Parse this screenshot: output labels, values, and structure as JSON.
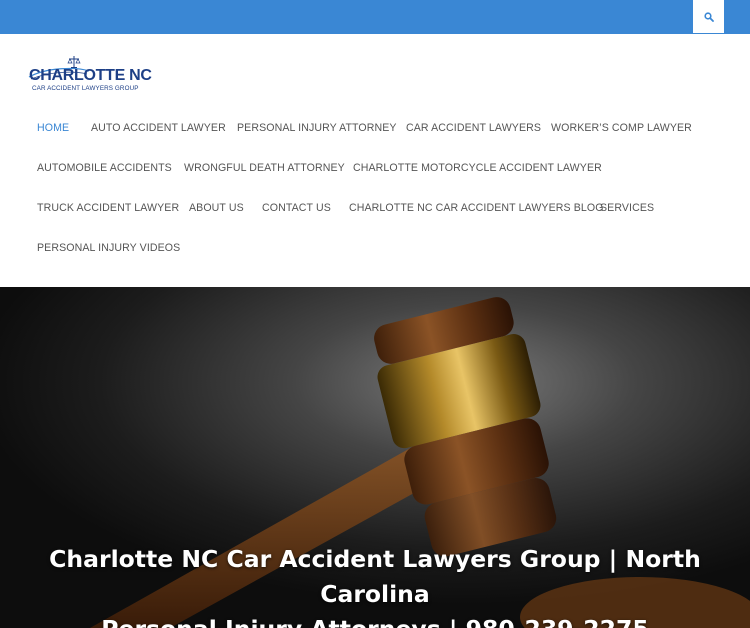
{
  "header": {
    "search_icon": "search-icon",
    "bar_color": "#3a87d4"
  },
  "logo": {
    "title": "CHARLOTTE NC",
    "subtitle": "CAR ACCIDENT LAWYERS GROUP"
  },
  "nav": {
    "active_color": "#3a87d4",
    "items": [
      {
        "label": "HOME",
        "active": true
      },
      {
        "label": "AUTO ACCIDENT LAWYER"
      },
      {
        "label": "PERSONAL INJURY ATTORNEY"
      },
      {
        "label": "CAR ACCIDENT LAWYERS"
      },
      {
        "label": "WORKER’S COMP LAWYER"
      },
      {
        "label": "AUTOMOBILE ACCIDENTS"
      },
      {
        "label": "WRONGFUL DEATH ATTORNEY"
      },
      {
        "label": "CHARLOTTE MOTORCYCLE ACCIDENT LAWYER"
      },
      {
        "label": "TRUCK ACCIDENT LAWYER"
      },
      {
        "label": "ABOUT US"
      },
      {
        "label": "CONTACT US"
      },
      {
        "label": "CHARLOTTE NC CAR ACCIDENT LAWYERS BLOG"
      },
      {
        "label": "SERVICES"
      },
      {
        "label": "PERSONAL INJURY VIDEOS"
      }
    ]
  },
  "hero": {
    "title_line1": "Charlotte NC Car Accident Lawyers Group | North Carolina",
    "title_line2": "Personal Injury Attorneys | 980-239-2275"
  }
}
